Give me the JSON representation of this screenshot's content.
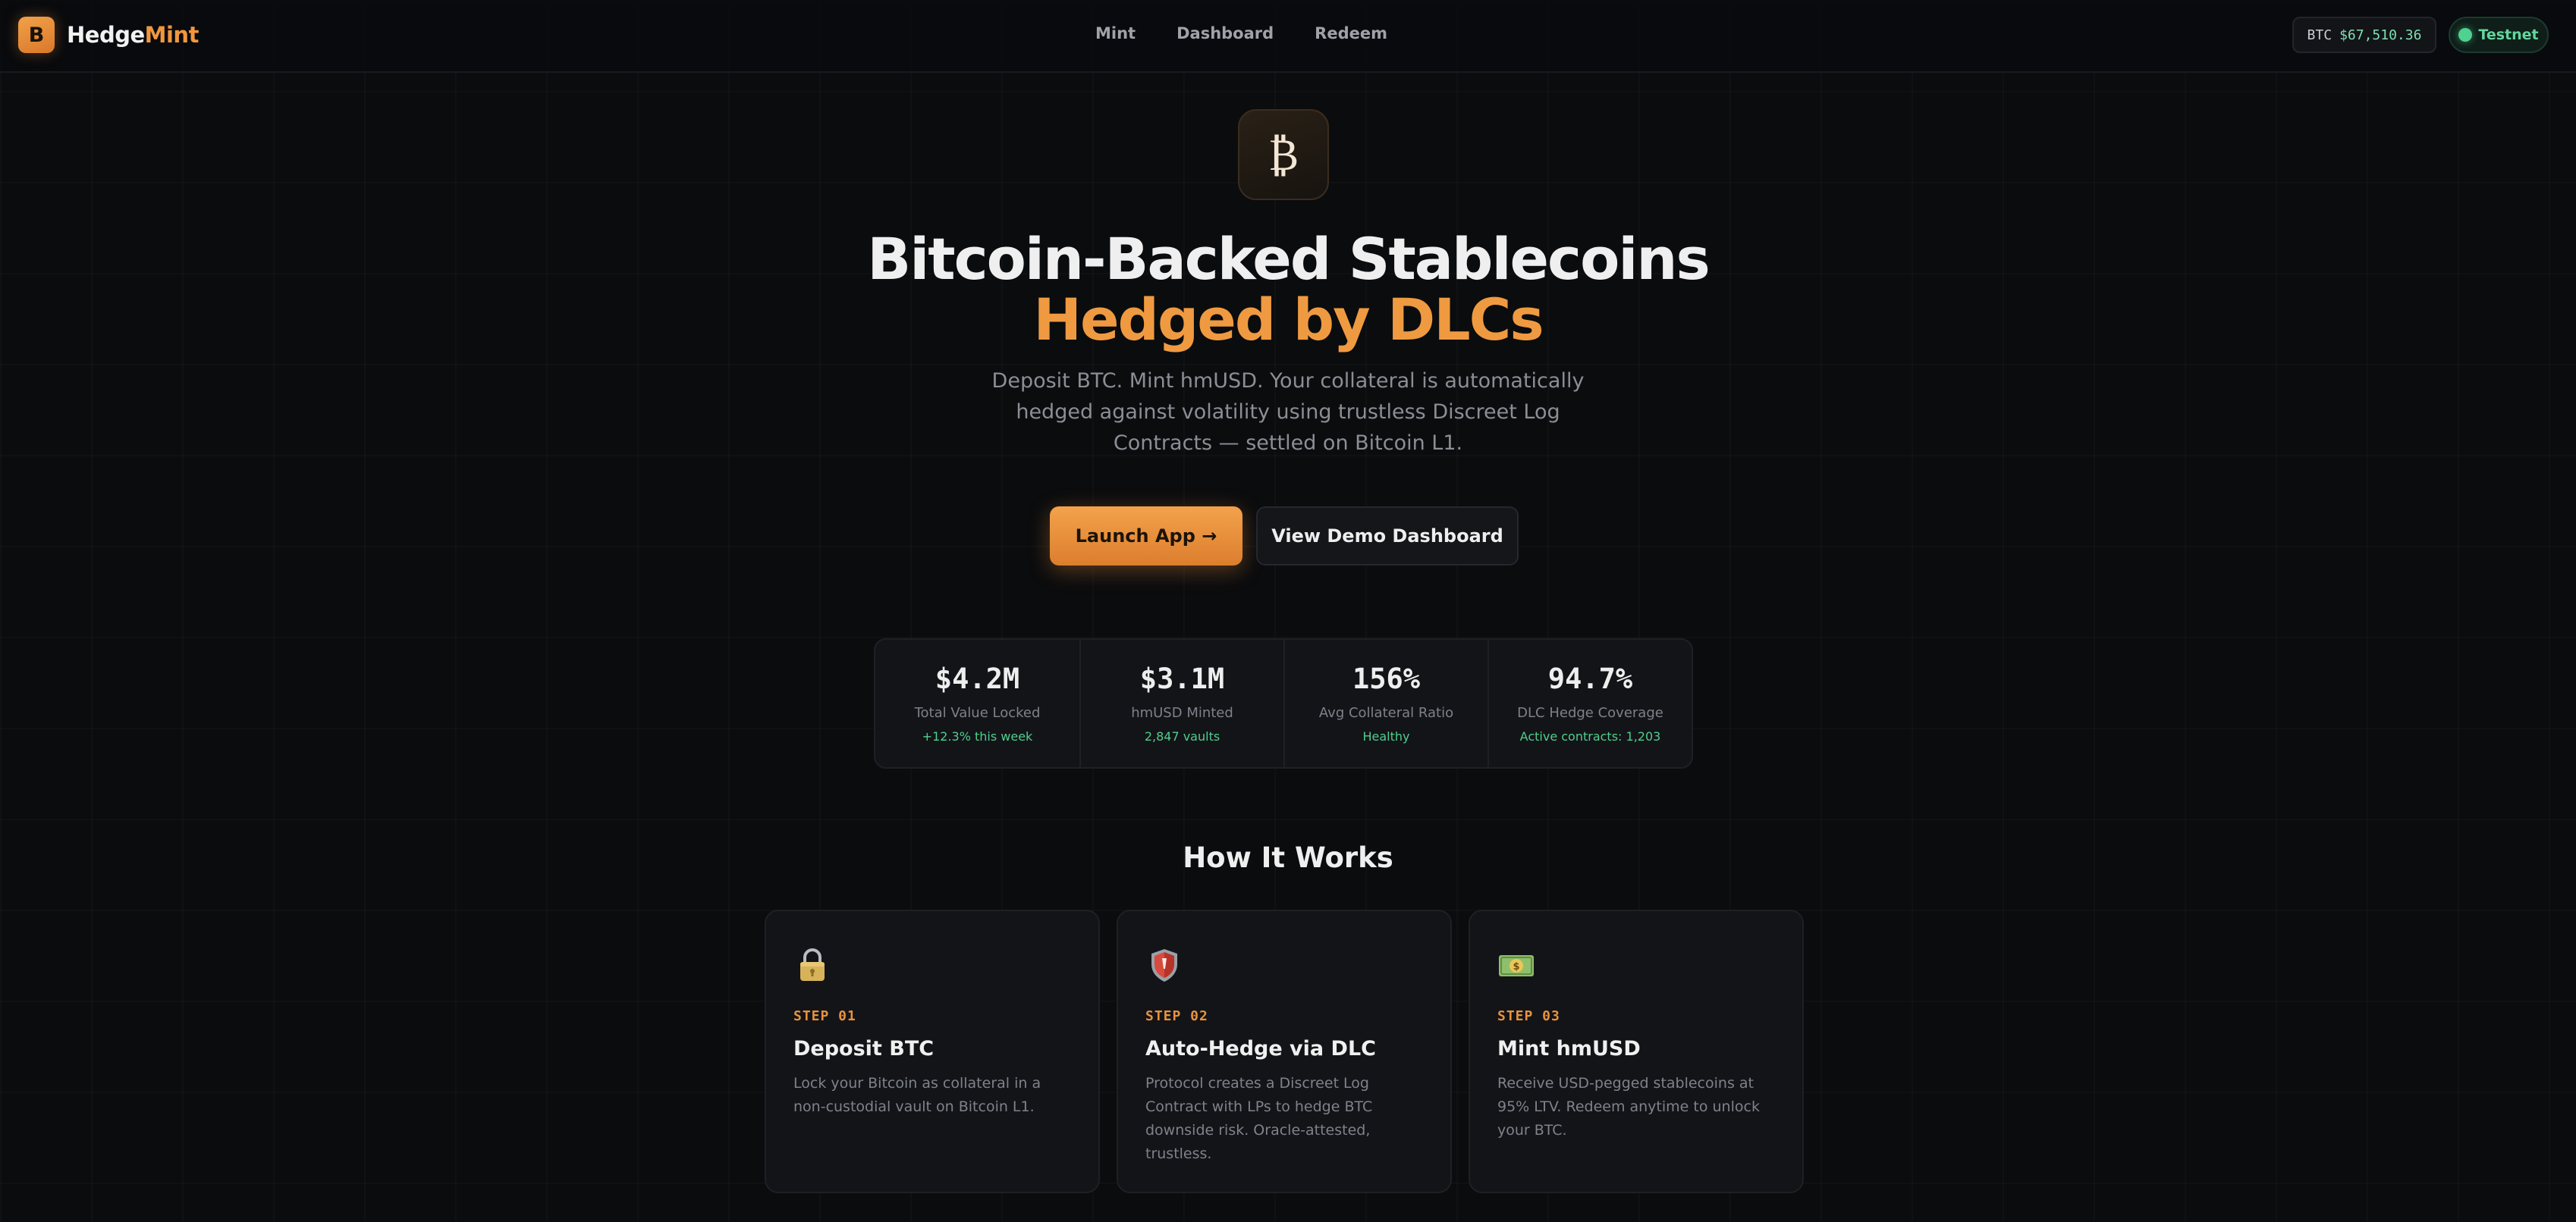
{
  "nav": {
    "logo_letter": "B",
    "brand_part1": "Hedge",
    "brand_part2": "Mint",
    "links": [
      "Mint",
      "Dashboard",
      "Redeem"
    ],
    "price_symbol": "BTC",
    "price_value": "$67,510.36",
    "network": "Testnet"
  },
  "hero": {
    "icon_glyph": "₿",
    "title_line1": "Bitcoin-Backed Stablecoins",
    "title_line2": "Hedged by DLCs",
    "subtitle": "Deposit BTC. Mint hmUSD. Your collateral is automatically hedged against volatility using trustless Discreet Log Contracts — settled on Bitcoin L1.",
    "primary_button": "Launch App →",
    "secondary_button": "View Demo Dashboard"
  },
  "stats": [
    {
      "value": "$4.2M",
      "label": "Total Value Locked",
      "note": "+12.3% this week"
    },
    {
      "value": "$3.1M",
      "label": "hmUSD Minted",
      "note": "2,847 vaults"
    },
    {
      "value": "156%",
      "label": "Avg Collateral Ratio",
      "note": "Healthy"
    },
    {
      "value": "94.7%",
      "label": "DLC Hedge Coverage",
      "note": "Active contracts: 1,203"
    }
  ],
  "how": {
    "title": "How It Works",
    "steps": [
      {
        "icon": "padlock-icon",
        "step": "STEP 01",
        "title": "Deposit BTC",
        "desc": "Lock your Bitcoin as collateral in a non-custodial vault on Bitcoin L1."
      },
      {
        "icon": "shield-icon",
        "step": "STEP 02",
        "title": "Auto-Hedge via DLC",
        "desc": "Protocol creates a Discreet Log Contract with LPs to hedge BTC downside risk. Oracle-attested, trustless."
      },
      {
        "icon": "dollar-banknote-icon",
        "step": "STEP 03",
        "title": "Mint hmUSD",
        "desc": "Receive USD-pegged stablecoins at 95% LTV. Redeem anytime to unlock your BTC."
      }
    ]
  },
  "colors": {
    "accent": "#ef9a41",
    "success": "#4fcf8d",
    "background": "#0b0c0e",
    "card": "#131418"
  }
}
